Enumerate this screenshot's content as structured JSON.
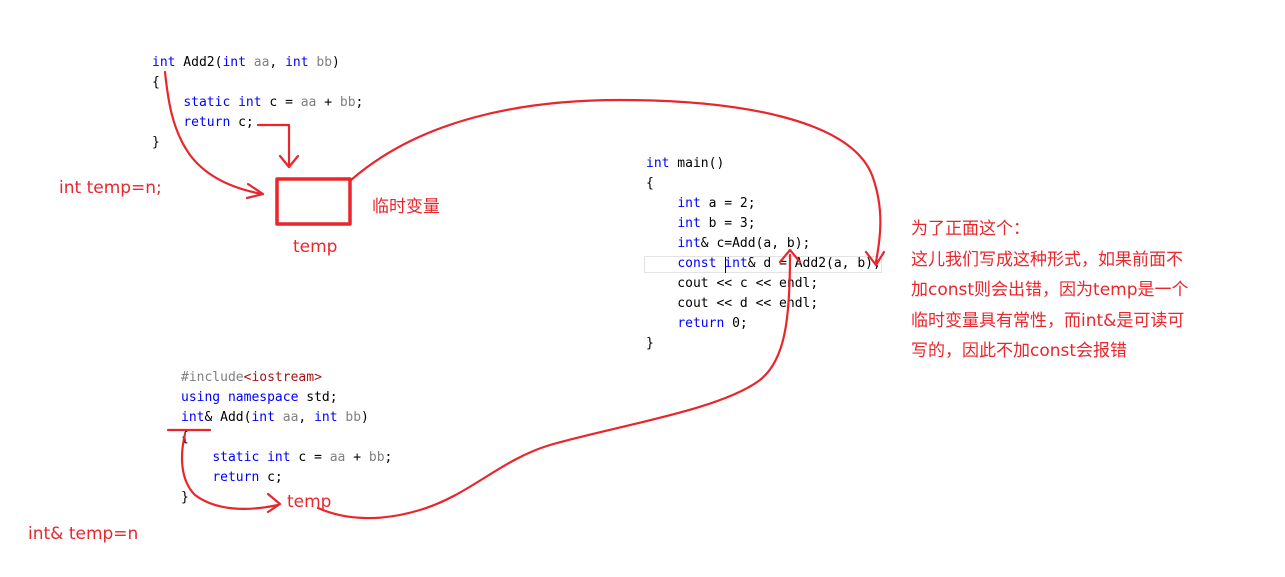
{
  "code_add2": {
    "lines": [
      [
        {
          "t": "int",
          "c": "kw"
        },
        {
          "t": " Add2(",
          "c": "id"
        },
        {
          "t": "int",
          "c": "kw"
        },
        {
          "t": " aa",
          "c": "pm"
        },
        {
          "t": ", ",
          "c": "id"
        },
        {
          "t": "int",
          "c": "kw"
        },
        {
          "t": " bb",
          "c": "pm"
        },
        {
          "t": ")",
          "c": "id"
        }
      ],
      [
        {
          "t": "{",
          "c": "id"
        }
      ],
      [
        {
          "t": "    ",
          "c": "id"
        },
        {
          "t": "static",
          "c": "kw"
        },
        {
          "t": " ",
          "c": "id"
        },
        {
          "t": "int",
          "c": "kw"
        },
        {
          "t": " c = ",
          "c": "id"
        },
        {
          "t": "aa",
          "c": "pm"
        },
        {
          "t": " + ",
          "c": "id"
        },
        {
          "t": "bb",
          "c": "pm"
        },
        {
          "t": ";",
          "c": "id"
        }
      ],
      [
        {
          "t": "    ",
          "c": "id"
        },
        {
          "t": "return",
          "c": "kw"
        },
        {
          "t": " c;",
          "c": "id"
        }
      ],
      [
        {
          "t": "}",
          "c": "id"
        }
      ]
    ]
  },
  "code_main": {
    "lines": [
      [
        {
          "t": "int",
          "c": "kw"
        },
        {
          "t": " main()",
          "c": "id"
        }
      ],
      [
        {
          "t": "{",
          "c": "id"
        }
      ],
      [
        {
          "t": "    ",
          "c": "id"
        },
        {
          "t": "int",
          "c": "kw"
        },
        {
          "t": " a = 2;",
          "c": "id"
        }
      ],
      [
        {
          "t": "    ",
          "c": "id"
        },
        {
          "t": "int",
          "c": "kw"
        },
        {
          "t": " b = 3;",
          "c": "id"
        }
      ],
      [
        {
          "t": "    ",
          "c": "id"
        },
        {
          "t": "int",
          "c": "kw"
        },
        {
          "t": "& c=Add(a, b);",
          "c": "id"
        }
      ],
      [
        {
          "t": "    ",
          "c": "id"
        },
        {
          "t": "const",
          "c": "kw"
        },
        {
          "t": " ",
          "c": "id"
        },
        {
          "t": "int",
          "c": "kw"
        },
        {
          "t": "& d = Add2(a, b);",
          "c": "id"
        }
      ],
      [
        {
          "t": "    cout << c << endl;",
          "c": "id"
        }
      ],
      [
        {
          "t": "    cout << d << endl;",
          "c": "id"
        }
      ],
      [
        {
          "t": "    ",
          "c": "id"
        },
        {
          "t": "return",
          "c": "kw"
        },
        {
          "t": " 0;",
          "c": "id"
        }
      ],
      [
        {
          "t": "}",
          "c": "id"
        }
      ]
    ]
  },
  "code_add": {
    "lines": [
      [
        {
          "t": "#include",
          "c": "inc"
        },
        {
          "t": "<iostream>",
          "c": "hdr"
        }
      ],
      [
        {
          "t": "using",
          "c": "kw"
        },
        {
          "t": " ",
          "c": "id"
        },
        {
          "t": "namespace",
          "c": "kw"
        },
        {
          "t": " std;",
          "c": "id"
        }
      ],
      [
        {
          "t": "int",
          "c": "kw"
        },
        {
          "t": "& Add(",
          "c": "id"
        },
        {
          "t": "int",
          "c": "kw"
        },
        {
          "t": " aa",
          "c": "pm"
        },
        {
          "t": ", ",
          "c": "id"
        },
        {
          "t": "int",
          "c": "kw"
        },
        {
          "t": " bb",
          "c": "pm"
        },
        {
          "t": ")",
          "c": "id"
        }
      ],
      [
        {
          "t": "{",
          "c": "id"
        }
      ],
      [
        {
          "t": "    ",
          "c": "id"
        },
        {
          "t": "static",
          "c": "kw"
        },
        {
          "t": " ",
          "c": "id"
        },
        {
          "t": "int",
          "c": "kw"
        },
        {
          "t": " c = ",
          "c": "id"
        },
        {
          "t": "aa",
          "c": "pm"
        },
        {
          "t": " + ",
          "c": "id"
        },
        {
          "t": "bb",
          "c": "pm"
        },
        {
          "t": ";",
          "c": "id"
        }
      ],
      [
        {
          "t": "    ",
          "c": "id"
        },
        {
          "t": "return",
          "c": "kw"
        },
        {
          "t": " c;",
          "c": "id"
        }
      ],
      [
        {
          "t": "}",
          "c": "id"
        }
      ]
    ]
  },
  "annotations": {
    "int_temp": "int temp=n;",
    "temp_var_label": "临时变量",
    "temp_box_label": "temp",
    "temp_ref_label": "temp",
    "int_ref_temp": "int& temp=n"
  },
  "explanation": {
    "lines": [
      "为了正面这个：",
      "这儿我们写成这种形式，如果前面不",
      "加const则会出错，因为temp是一个",
      "临时变量具有常性，而int&是可读可",
      "写的，因此不加const会报错"
    ]
  },
  "colors": {
    "annotation": "#e8262c",
    "keyword": "#0000ff",
    "param": "#808080",
    "header": "#a31515"
  }
}
